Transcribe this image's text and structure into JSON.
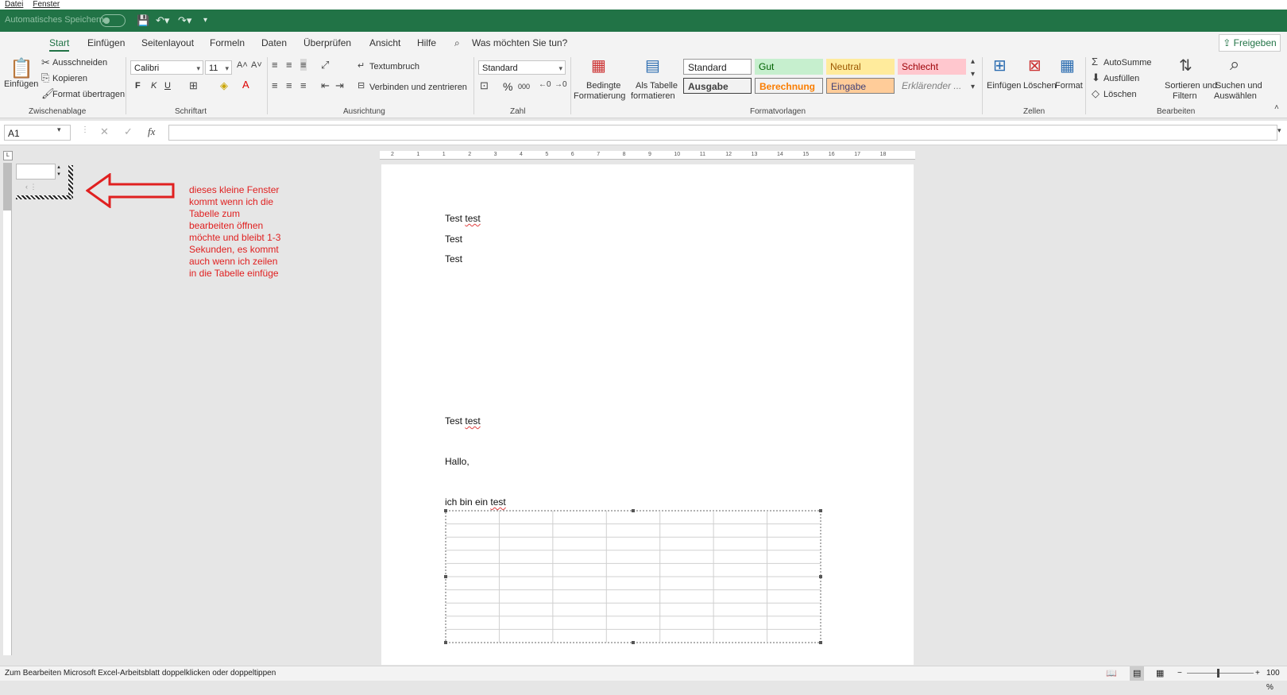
{
  "menubar": {
    "file": "Datei",
    "window": "Fenster"
  },
  "qat": {
    "autosave_label": "Automatisches Speichern"
  },
  "tabs": [
    "Start",
    "Einfügen",
    "Seitenlayout",
    "Formeln",
    "Daten",
    "Überprüfen",
    "Ansicht",
    "Hilfe"
  ],
  "tellme": "Was möchten Sie tun?",
  "share": "Freigeben",
  "clipboard": {
    "paste": "Einfügen",
    "cut": "Ausschneiden",
    "copy": "Kopieren",
    "format_painter": "Format übertragen",
    "label": "Zwischenablage"
  },
  "font": {
    "name": "Calibri",
    "size": "11",
    "bold": "F",
    "italic": "K",
    "underline": "U",
    "label": "Schriftart"
  },
  "alignment": {
    "wrap": "Textumbruch",
    "merge": "Verbinden und zentrieren",
    "label": "Ausrichtung"
  },
  "number": {
    "format": "Standard",
    "percent": "%",
    "thousands": "000",
    "label": "Zahl"
  },
  "styles": {
    "conditional": [
      "Bedingte",
      "Formatierung"
    ],
    "as_table": [
      "Als Tabelle",
      "formatieren"
    ],
    "cells": [
      "Standard",
      "Gut",
      "Neutral",
      "Schlecht",
      "Ausgabe",
      "Berechnung",
      "Eingabe",
      "Erklärender ..."
    ],
    "label": "Formatvorlagen"
  },
  "cells_group": {
    "insert": "Einfügen",
    "delete": "Löschen",
    "format": "Format",
    "label": "Zellen"
  },
  "editing": {
    "autosum": "AutoSumme",
    "fill": "Ausfüllen",
    "clear": "Löschen",
    "sort": [
      "Sortieren und",
      "Filtern"
    ],
    "find": [
      "Suchen und",
      "Auswählen"
    ],
    "label": "Bearbeiten"
  },
  "formula": {
    "namebox": "A1",
    "fx": "fx"
  },
  "ruler_top": [
    "2",
    "1",
    "1",
    "2",
    "3",
    "4",
    "5",
    "6",
    "7",
    "8",
    "9",
    "10",
    "11",
    "12",
    "13",
    "14",
    "15",
    "16",
    "17",
    "18"
  ],
  "document": {
    "lines": [
      "Test",
      "test",
      "Test",
      "Test",
      "Test",
      "test",
      "Hallo,",
      "ich bin ein",
      "test"
    ]
  },
  "annotation": [
    "dieses kleine Fenster",
    "kommt wenn ich die",
    "Tabelle zum",
    "bearbeiten öffnen",
    "möchte und bleibt 1-3",
    "Sekunden, es kommt",
    "auch wenn ich zeilen",
    "in die Tabelle einfüge"
  ],
  "status": {
    "message": "Zum Bearbeiten Microsoft Excel-Arbeitsblatt doppelklicken oder doppeltippen",
    "zoom": "100 %"
  },
  "colors": {
    "accent": "#217346",
    "annotation": "#e02020"
  }
}
